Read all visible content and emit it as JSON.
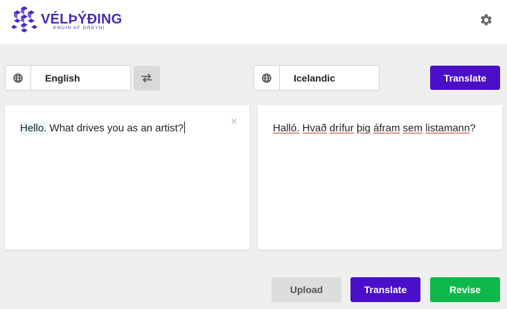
{
  "brand": {
    "name": "VÉLÞÝÐING",
    "tagline": "KNÚIN AF GREYNI",
    "logo_color": "#4a2bb8"
  },
  "header": {
    "settings_icon": "gear-icon"
  },
  "languages": {
    "source": "English",
    "target": "Icelandic",
    "globe_icon": "globe-icon",
    "swap_icon": "swap-arrows-icon"
  },
  "actions": {
    "translate_top": "Translate",
    "upload": "Upload",
    "translate_bottom": "Translate",
    "revise": "Revise"
  },
  "source_panel": {
    "segments": [
      "Hello.",
      "What drives you as an artist?"
    ],
    "clear_icon": "×"
  },
  "target_panel": {
    "words": [
      "Halló.",
      "Hvað",
      "drífur",
      "þig",
      "áfram",
      "sem",
      "listamann",
      "?"
    ]
  },
  "colors": {
    "primary": "#4b0fc9",
    "revise": "#0fb84a",
    "upload_bg": "#dddddd",
    "highlight": "#e9f7f7",
    "spellcheck_underline": "#c0392b"
  }
}
